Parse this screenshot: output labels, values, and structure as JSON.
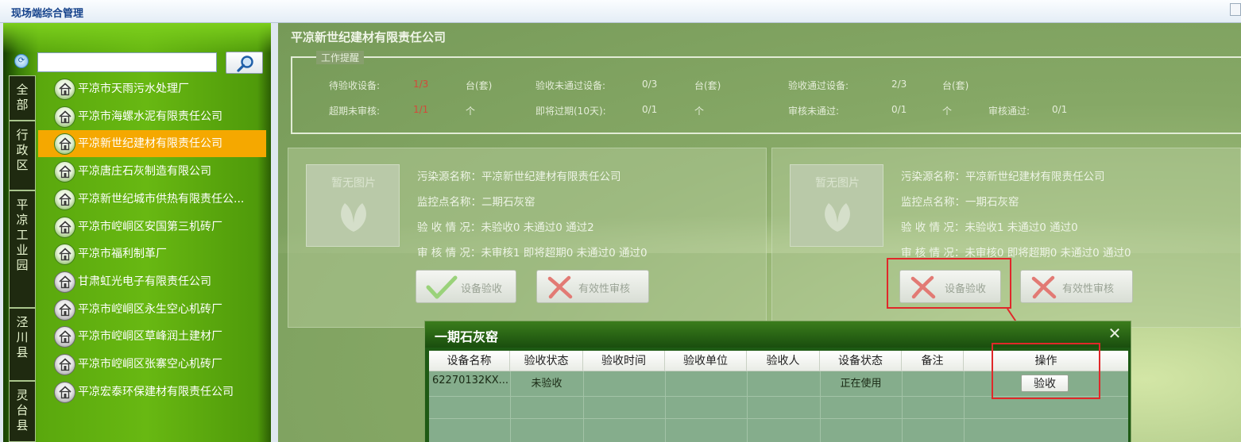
{
  "window": {
    "title": "现场端综合管理"
  },
  "sidebar": {
    "search": {
      "value": "",
      "placeholder": ""
    },
    "regions": [
      {
        "label": "全部"
      },
      {
        "label": "行政区"
      },
      {
        "label": "平凉工业园"
      },
      {
        "label": "泾川县"
      },
      {
        "label": "灵台县"
      }
    ],
    "companies": [
      {
        "name": "平凉市天雨污水处理厂",
        "icon": "green"
      },
      {
        "name": "平凉市海螺水泥有限责任公司",
        "icon": "green"
      },
      {
        "name": "平凉新世纪建材有限责任公司",
        "icon": "green",
        "selected": true
      },
      {
        "name": "平凉唐庄石灰制造有限公司",
        "icon": "green"
      },
      {
        "name": "平凉新世纪城市供热有限责任公...",
        "icon": "green"
      },
      {
        "name": "平凉市崆峒区安国第三机砖厂",
        "icon": "green"
      },
      {
        "name": "平凉市福利制革厂",
        "icon": "green"
      },
      {
        "name": "甘肃虹光电子有限责任公司",
        "icon": "gray"
      },
      {
        "name": "平凉市崆峒区永生空心机砖厂",
        "icon": "gray"
      },
      {
        "name": "平凉市崆峒区草峰润土建材厂",
        "icon": "gray"
      },
      {
        "name": "平凉市崆峒区张寨空心机砖厂",
        "icon": "gray"
      },
      {
        "name": "平凉宏泰环保建材有限责任公司",
        "icon": "gray"
      }
    ]
  },
  "main": {
    "company_title": "平凉新世纪建材有限责任公司",
    "summary": {
      "legend": "工作提醒",
      "pending_label": "待验收设备:",
      "pending_value": "1/3",
      "pending_unit": "台(套)",
      "failed_label": "验收未通过设备:",
      "failed_value": "0/3",
      "failed_unit": "台(套)",
      "passed_label": "验收通过设备:",
      "passed_value": "2/3",
      "passed_unit": "台(套)",
      "overdue_label": "超期未审核:",
      "overdue_value": "1/1",
      "overdue_unit": "个",
      "expiring_label": "即将过期(10天):",
      "expiring_value": "0/1",
      "expiring_unit": "个",
      "review_fail_label": "审核未通过:",
      "review_fail_value": "0/1",
      "review_fail_unit": "个",
      "review_pass_label": "审核通过:",
      "review_pass_value": "0/1"
    },
    "cards": [
      {
        "no_image": "暂无图片",
        "pollution_source": "污染源名称：平凉新世纪建材有限责任公司",
        "monitor_point": "监控点名称：二期石灰窑",
        "acceptance": "验 收 情 况：未验收0 未通过0 通过2",
        "review": "审 核 情 况：未审核1 即将超期0 未通过0 通过0",
        "btn_accept": "设备验收",
        "btn_accept_state": "check",
        "btn_review": "有效性审核"
      },
      {
        "no_image": "暂无图片",
        "pollution_source": "污染源名称：平凉新世纪建材有限责任公司",
        "monitor_point": "监控点名称：一期石灰窑",
        "acceptance": "验 收 情 况：未验收1 未通过0 通过0",
        "review": "审 核 情 况：未审核0 即将超期0 未通过0 通过0",
        "btn_accept": "设备验收",
        "btn_accept_state": "cross",
        "btn_review": "有效性审核"
      }
    ]
  },
  "dialog": {
    "title": "一期石灰窑",
    "close": "✕",
    "columns": [
      "设备名称",
      "验收状态",
      "验收时间",
      "验收单位",
      "验收人",
      "设备状态",
      "备注",
      "操作"
    ],
    "rows": [
      {
        "device_name": "62270132KX...",
        "accept_status": "未验收",
        "accept_time": "",
        "accept_unit": "",
        "acceptor": "",
        "device_status": "正在使用",
        "remark": "",
        "action": "验收"
      }
    ]
  },
  "colors": {
    "accent_red": "#e0282a",
    "selected_item": "#f5a800"
  }
}
